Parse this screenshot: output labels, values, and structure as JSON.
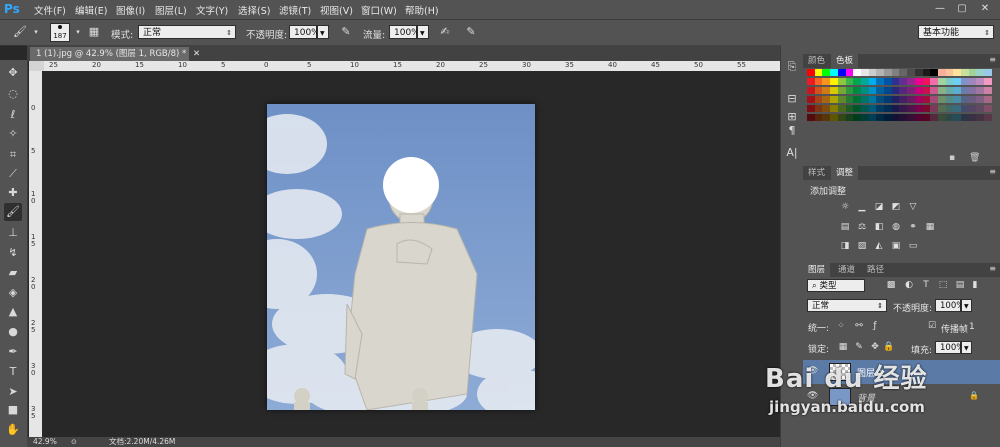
{
  "app": {
    "logo": "Ps"
  },
  "menubar": {
    "items": [
      "文件(F)",
      "编辑(E)",
      "图像(I)",
      "图层(L)",
      "文字(Y)",
      "选择(S)",
      "滤镜(T)",
      "视图(V)",
      "窗口(W)",
      "帮助(H)"
    ],
    "window_buttons": [
      "—",
      "▢",
      "✕"
    ]
  },
  "options_bar": {
    "brush_size": "187",
    "mode_label": "模式:",
    "mode_value": "正常",
    "opacity_label": "不透明度:",
    "opacity_value": "100%",
    "flow_label": "流量:",
    "flow_value": "100%",
    "workspace": "基本功能"
  },
  "document": {
    "tab_title": "1 (1).jpg @ 42.9% (图层 1, RGB/8) *",
    "ruler_top_ticks": [
      "25",
      "20",
      "15",
      "10",
      "5",
      "0",
      "5",
      "10",
      "15",
      "20",
      "25",
      "30",
      "35",
      "40",
      "45",
      "50",
      "55"
    ],
    "ruler_left_ticks": [
      "0",
      "5",
      "1\n0",
      "1\n5",
      "2\n0",
      "2\n5",
      "3\n0",
      "3\n5"
    ],
    "zoom": "42.9%",
    "doc_size": "文档:2.20M/4.26M"
  },
  "panels": {
    "color_tabs": [
      "颜色",
      "色板"
    ],
    "style_tabs": [
      "样式",
      "调整"
    ],
    "add_adjustment": "添加调整",
    "layers_tabs": [
      "图层",
      "通道",
      "路径"
    ],
    "filter_kind": "类型",
    "blend_mode": "正常",
    "opacity_label": "不透明度:",
    "opacity_value": "100%",
    "unify_label": "统一:",
    "propagate_label": "传播帧",
    "propagate_value": "1",
    "lock_label": "锁定:",
    "fill_label": "填充:",
    "fill_value": "100%",
    "layers": [
      {
        "name": "图层 1"
      },
      {
        "name": "背景"
      }
    ]
  },
  "watermark": {
    "brand": "Bai du 经验",
    "url": "jingyan.baidu.com"
  },
  "colors": {
    "accent": "#31a8ff",
    "panel": "#535353",
    "workspace": "#282828"
  }
}
